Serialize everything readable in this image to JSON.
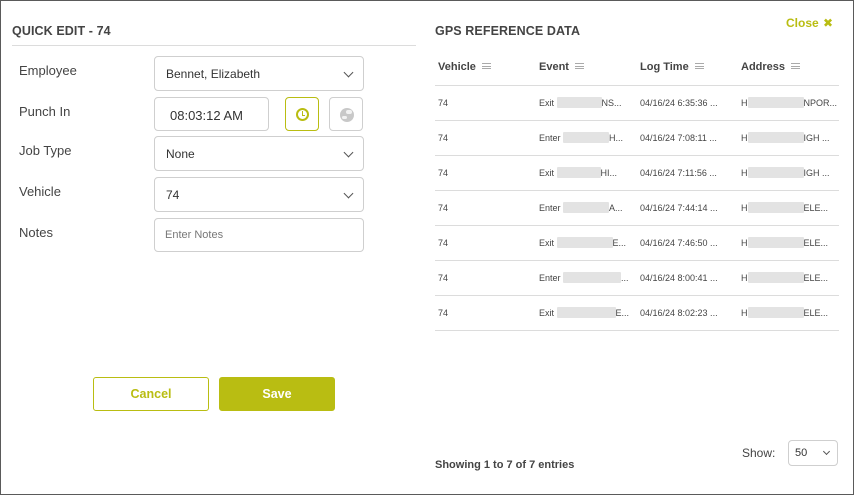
{
  "quick_edit": {
    "title": "QUICK EDIT - 74",
    "employee": {
      "label": "Employee",
      "value": "Bennet, Elizabeth"
    },
    "punch_in": {
      "label": "Punch In",
      "value": "08:03:12 AM"
    },
    "job_type": {
      "label": "Job Type",
      "value": "None"
    },
    "vehicle": {
      "label": "Vehicle",
      "value": "74"
    },
    "notes": {
      "label": "Notes",
      "value": "",
      "placeholder": "Enter Notes"
    },
    "cancel_label": "Cancel",
    "save_label": "Save"
  },
  "gps": {
    "title": "GPS REFERENCE DATA",
    "close_label": "Close",
    "columns": [
      "Vehicle",
      "Event",
      "Log Time",
      "Address"
    ],
    "rows": [
      {
        "vehicle": "74",
        "event_prefix": "Exit",
        "event_suffix": "NS...",
        "log_time": "04/16/24 6:35:36 ...",
        "address_prefix": "H",
        "address_suffix": "NPOR..."
      },
      {
        "vehicle": "74",
        "event_prefix": "Enter",
        "event_suffix": "H...",
        "log_time": "04/16/24 7:08:11 ...",
        "address_prefix": "H",
        "address_suffix": "IGH ..."
      },
      {
        "vehicle": "74",
        "event_prefix": "Exit",
        "event_suffix": "HI...",
        "log_time": "04/16/24 7:11:56 ...",
        "address_prefix": "H",
        "address_suffix": "IGH ..."
      },
      {
        "vehicle": "74",
        "event_prefix": "Enter",
        "event_suffix": "A...",
        "log_time": "04/16/24 7:44:14 ...",
        "address_prefix": "H",
        "address_suffix": "ELE..."
      },
      {
        "vehicle": "74",
        "event_prefix": "Exit",
        "event_suffix": "E...",
        "log_time": "04/16/24 7:46:50 ...",
        "address_prefix": "H",
        "address_suffix": "ELE..."
      },
      {
        "vehicle": "74",
        "event_prefix": "Enter",
        "event_suffix": "...",
        "log_time": "04/16/24 8:00:41 ...",
        "address_prefix": "H",
        "address_suffix": "ELE..."
      },
      {
        "vehicle": "74",
        "event_prefix": "Exit",
        "event_suffix": "E...",
        "log_time": "04/16/24 8:02:23 ...",
        "address_prefix": "H",
        "address_suffix": "ELE..."
      }
    ],
    "showing_text": "Showing 1 to 7 of 7 entries",
    "show_label": "Show:",
    "page_size": "50"
  },
  "colors": {
    "accent": "#b9bd12",
    "border": "#cfcfcf",
    "divider": "#dcdcdc"
  },
  "icons": {
    "close": "close-x-icon",
    "clock": "clock-icon",
    "globe": "globe-icon",
    "sort": "sort-icon",
    "chevron": "chevron-down-icon"
  }
}
